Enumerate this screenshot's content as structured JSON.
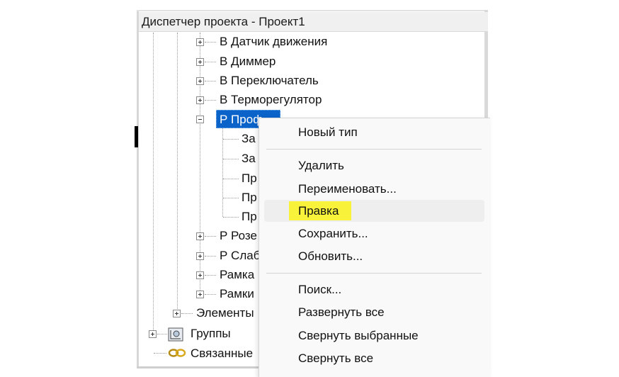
{
  "panel": {
    "title": "Диспетчер проекта - Проект1"
  },
  "tree": {
    "items": [
      {
        "label": "В Датчик движения",
        "expander": "plus"
      },
      {
        "label": "В Диммер",
        "expander": "plus"
      },
      {
        "label": "В Переключатель",
        "expander": "plus"
      },
      {
        "label": "В Терморегулятор",
        "expander": "plus"
      },
      {
        "label": "Р Проф",
        "expander": "minus",
        "selected": true
      },
      {
        "label": "За"
      },
      {
        "label": "За"
      },
      {
        "label": "Пр"
      },
      {
        "label": "Пр"
      },
      {
        "label": "Пр"
      },
      {
        "label": "Р Розе",
        "expander": "plus"
      },
      {
        "label": "Р Слаб",
        "expander": "plus"
      },
      {
        "label": "Рамка",
        "expander": "plus"
      },
      {
        "label": "Рамки",
        "expander": "plus"
      },
      {
        "label": "Элементы",
        "expander": "plus"
      },
      {
        "label": "Группы",
        "expander": "plus",
        "icon": "groups-icon"
      },
      {
        "label": "Связанные",
        "icon": "link-icon"
      }
    ]
  },
  "context_menu": {
    "items": [
      "Новый тип",
      "Удалить",
      "Переименовать...",
      "Правка",
      "Сохранить...",
      "Обновить...",
      "Поиск...",
      "Развернуть все",
      "Свернуть выбранные",
      "Свернуть все"
    ],
    "highlight_color": "#f8f23a",
    "hovered_item": "Правка"
  },
  "colors": {
    "selection": "#0a63c9",
    "menu_background": "#f9f9f9",
    "title_background": "#f0f0f0"
  }
}
